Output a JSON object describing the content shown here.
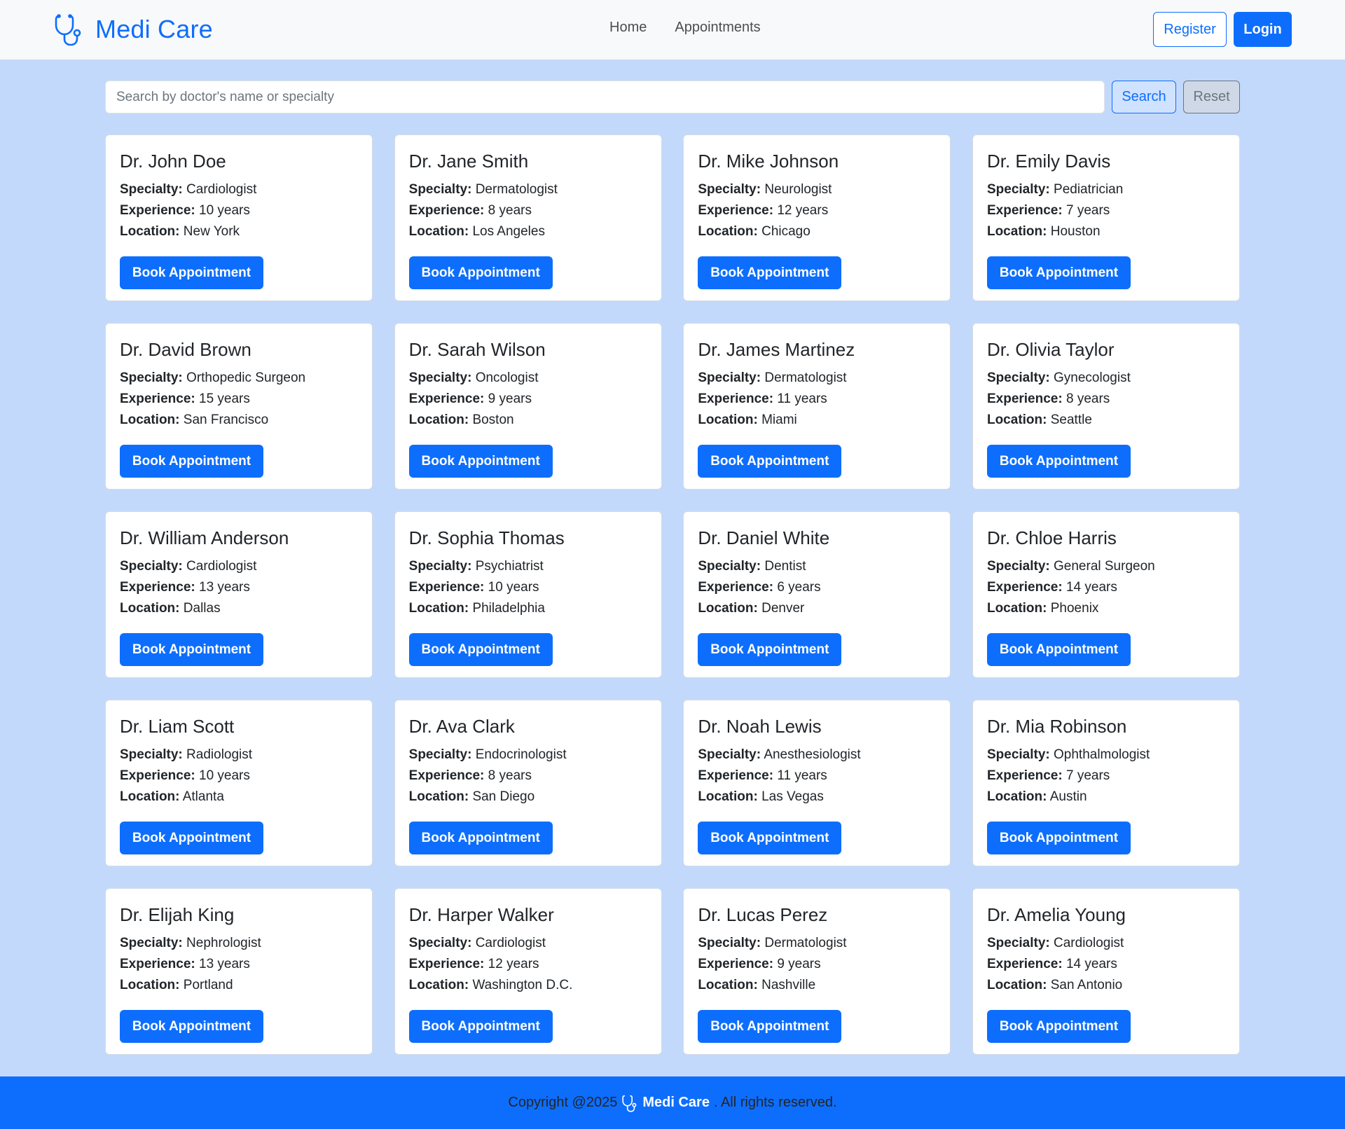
{
  "brand": {
    "name": "Medi Care",
    "icon": "stethoscope-icon",
    "color": "#0d6efd"
  },
  "nav": {
    "links": [
      "Home",
      "Appointments"
    ],
    "register": "Register",
    "login": "Login"
  },
  "search": {
    "placeholder": "Search by doctor's name or specialty",
    "value": "",
    "search_label": "Search",
    "reset_label": "Reset"
  },
  "labels": {
    "specialty": "Specialty:",
    "experience": "Experience:",
    "location": "Location:",
    "book": "Book Appointment"
  },
  "doctors": [
    {
      "name": "Dr. John Doe",
      "specialty": "Cardiologist",
      "experience": "10 years",
      "location": "New York"
    },
    {
      "name": "Dr. Jane Smith",
      "specialty": "Dermatologist",
      "experience": "8 years",
      "location": "Los Angeles"
    },
    {
      "name": "Dr. Mike Johnson",
      "specialty": "Neurologist",
      "experience": "12 years",
      "location": "Chicago"
    },
    {
      "name": "Dr. Emily Davis",
      "specialty": "Pediatrician",
      "experience": "7 years",
      "location": "Houston"
    },
    {
      "name": "Dr. David Brown",
      "specialty": "Orthopedic Surgeon",
      "experience": "15 years",
      "location": "San Francisco"
    },
    {
      "name": "Dr. Sarah Wilson",
      "specialty": "Oncologist",
      "experience": "9 years",
      "location": "Boston"
    },
    {
      "name": "Dr. James Martinez",
      "specialty": "Dermatologist",
      "experience": "11 years",
      "location": "Miami"
    },
    {
      "name": "Dr. Olivia Taylor",
      "specialty": "Gynecologist",
      "experience": "8 years",
      "location": "Seattle"
    },
    {
      "name": "Dr. William Anderson",
      "specialty": "Cardiologist",
      "experience": "13 years",
      "location": "Dallas"
    },
    {
      "name": "Dr. Sophia Thomas",
      "specialty": "Psychiatrist",
      "experience": "10 years",
      "location": "Philadelphia"
    },
    {
      "name": "Dr. Daniel White",
      "specialty": "Dentist",
      "experience": "6 years",
      "location": "Denver"
    },
    {
      "name": "Dr. Chloe Harris",
      "specialty": "General Surgeon",
      "experience": "14 years",
      "location": "Phoenix"
    },
    {
      "name": "Dr. Liam Scott",
      "specialty": "Radiologist",
      "experience": "10 years",
      "location": "Atlanta"
    },
    {
      "name": "Dr. Ava Clark",
      "specialty": "Endocrinologist",
      "experience": "8 years",
      "location": "San Diego"
    },
    {
      "name": "Dr. Noah Lewis",
      "specialty": "Anesthesiologist",
      "experience": "11 years",
      "location": "Las Vegas"
    },
    {
      "name": "Dr. Mia Robinson",
      "specialty": "Ophthalmologist",
      "experience": "7 years",
      "location": "Austin"
    },
    {
      "name": "Dr. Elijah King",
      "specialty": "Nephrologist",
      "experience": "13 years",
      "location": "Portland"
    },
    {
      "name": "Dr. Harper Walker",
      "specialty": "Cardiologist",
      "experience": "12 years",
      "location": "Washington D.C."
    },
    {
      "name": "Dr. Lucas Perez",
      "specialty": "Dermatologist",
      "experience": "9 years",
      "location": "Nashville"
    },
    {
      "name": "Dr. Amelia Young",
      "specialty": "Cardiologist",
      "experience": "14 years",
      "location": "San Antonio"
    }
  ],
  "footer": {
    "prefix": "Copyright @2025",
    "brand": "Medi Care",
    "suffix": ". All rights reserved.",
    "icon": "stethoscope-icon"
  },
  "colors": {
    "primary": "#0d6efd",
    "background": "#c3d9fb",
    "navbar": "#f8f9fa"
  }
}
